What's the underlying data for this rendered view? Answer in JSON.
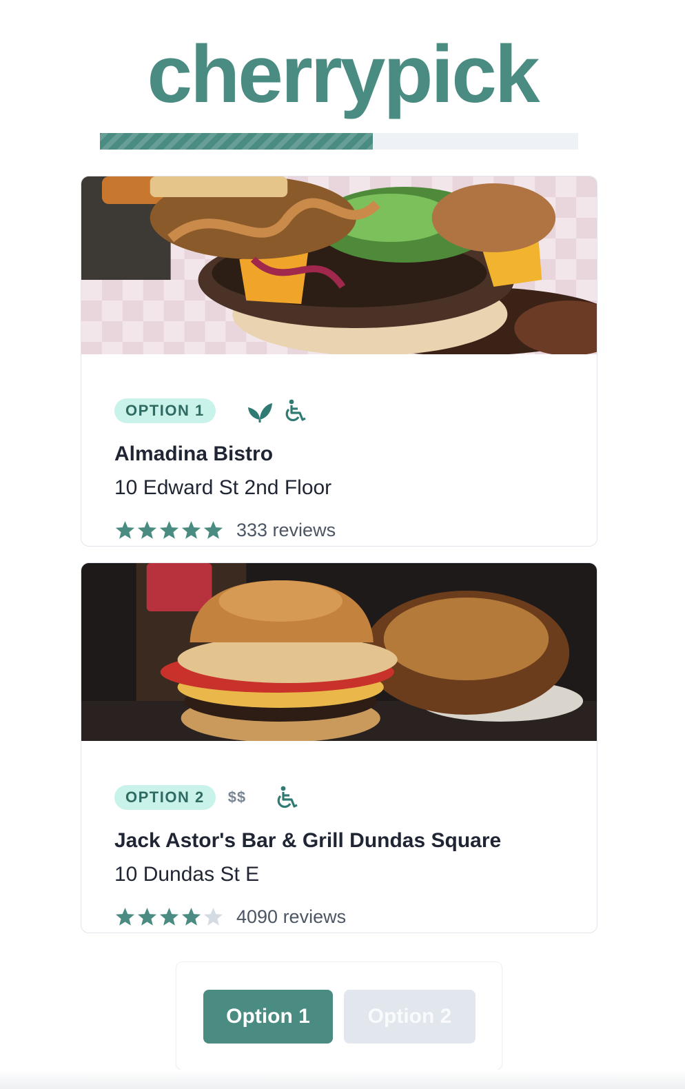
{
  "app": {
    "logo_text": "cherrypick",
    "brand_color": "#4a8b82",
    "progress_fraction": 0.57
  },
  "options": [
    {
      "badge": "OPTION 1",
      "price": "",
      "icons": [
        "vegetarian-leaf-icon",
        "wheelchair-accessible-icon"
      ],
      "name": "Almadina Bistro",
      "address": "10 Edward St 2nd Floor",
      "rating": 5,
      "reviews": "333 reviews",
      "photo": "burger-with-onions-photo"
    },
    {
      "badge": "OPTION 2",
      "price": "$$",
      "icons": [
        "wheelchair-accessible-icon"
      ],
      "name": "Jack Astor's Bar & Grill Dundas Square",
      "address": "10 Dundas St E",
      "rating": 4,
      "reviews": "4090 reviews",
      "photo": "burger-and-poutine-photo"
    }
  ],
  "chooser": {
    "option1_label": "Option 1",
    "option2_label": "Option 2"
  }
}
